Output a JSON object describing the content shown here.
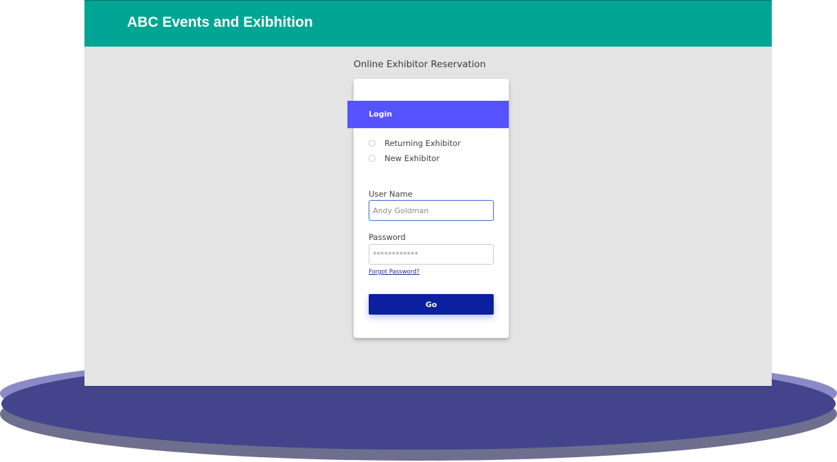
{
  "header": {
    "app_title": "ABC Events and Exibhition"
  },
  "page": {
    "title": "Online Exhibitor Reservation"
  },
  "login": {
    "banner_label": "Login",
    "options": [
      {
        "label": "Returning Exhibitor",
        "selected": false
      },
      {
        "label": "New Exhibitor",
        "selected": false
      }
    ],
    "username": {
      "label": "User Name",
      "placeholder": "Andy Goldman"
    },
    "password": {
      "label": "Password",
      "placeholder": "************"
    },
    "forgot_label": "Forgot Password?",
    "go_label": "Go"
  },
  "colors": {
    "header_bg": "#00a594",
    "banner_bg": "#5552fe",
    "button_bg": "#0a209e",
    "screen_bg": "#e4e4e4",
    "base_ellipse": "#43448c"
  }
}
